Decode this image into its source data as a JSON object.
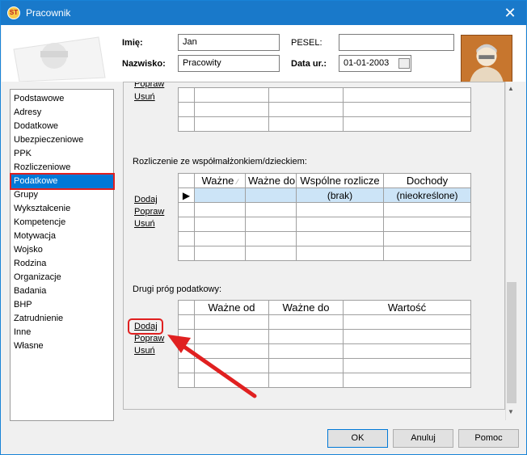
{
  "window": {
    "title": "Pracownik"
  },
  "header": {
    "imie_label": "Imię:",
    "imie_value": "Jan",
    "nazwisko_label": "Nazwisko:",
    "nazwisko_value": "Pracowity",
    "pesel_label": "PESEL:",
    "pesel_value": "",
    "data_label": "Data ur.:",
    "data_value": "01-01-2003"
  },
  "sidebar": {
    "items": [
      {
        "label": "Podstawowe"
      },
      {
        "label": "Adresy"
      },
      {
        "label": "Dodatkowe"
      },
      {
        "label": "Ubezpieczeniowe"
      },
      {
        "label": "PPK"
      },
      {
        "label": "Rozliczeniowe"
      },
      {
        "label": "Podatkowe"
      },
      {
        "label": "Grupy"
      },
      {
        "label": "Wykształcenie"
      },
      {
        "label": "Kompetencje"
      },
      {
        "label": "Motywacja"
      },
      {
        "label": "Wojsko"
      },
      {
        "label": "Rodzina"
      },
      {
        "label": "Organizacje"
      },
      {
        "label": "Badania"
      },
      {
        "label": "BHP"
      },
      {
        "label": "Zatrudnienie"
      },
      {
        "label": "Inne"
      },
      {
        "label": "Własne"
      }
    ],
    "selected": "Podatkowe"
  },
  "section_top": {
    "links": {
      "popraw": "Popraw",
      "usun": "Usuń"
    }
  },
  "section_spouse": {
    "title": "Rozliczenie ze współmałżonkiem/dzieckiem:",
    "links": {
      "dodaj": "Dodaj",
      "popraw": "Popraw",
      "usun": "Usuń"
    },
    "columns": [
      "Ważne",
      "Ważne do",
      "Wspólne rozlicze",
      "Dochody"
    ],
    "row": {
      "wspolne": "(brak)",
      "dochody": "(nieokreślone)"
    }
  },
  "section_threshold": {
    "title": "Drugi próg podatkowy:",
    "links": {
      "dodaj": "Dodaj",
      "popraw": "Popraw",
      "usun": "Usuń"
    },
    "columns": [
      "Ważne od",
      "Ważne do",
      "Wartość"
    ]
  },
  "buttons": {
    "ok": "OK",
    "anuluj": "Anuluj",
    "pomoc": "Pomoc"
  },
  "colors": {
    "accent": "#1979ca",
    "selection": "#0078d7",
    "annotation": "#e02020"
  }
}
